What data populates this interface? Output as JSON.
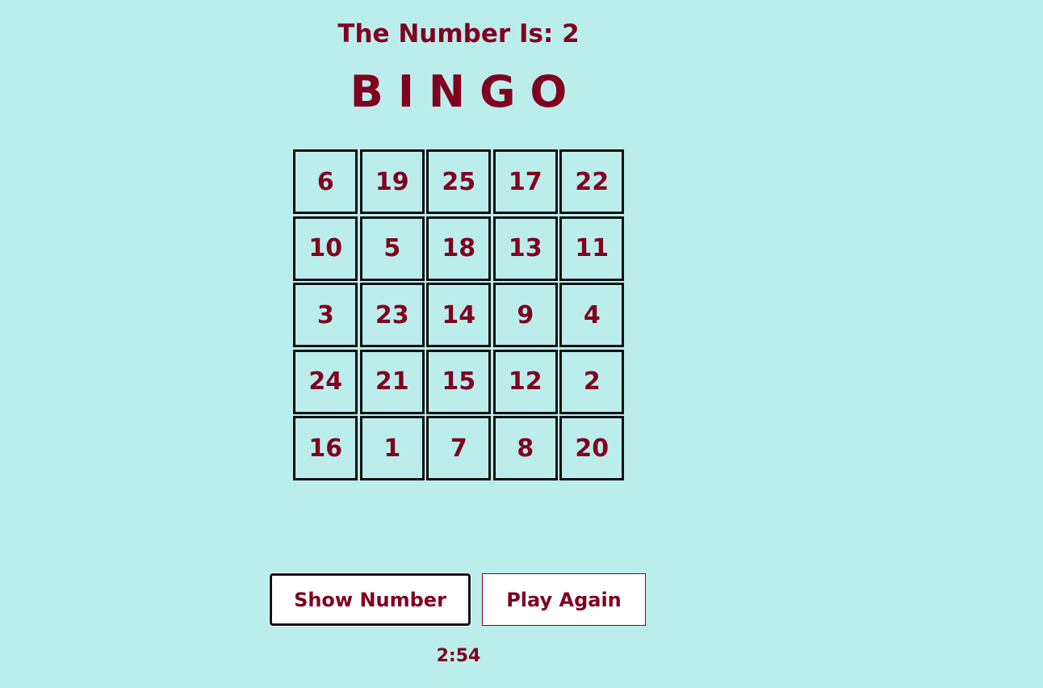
{
  "header": {
    "number_label": "The Number Is: 2",
    "title": "BINGO"
  },
  "board": {
    "cells": [
      [
        "6",
        "19",
        "25",
        "17",
        "22"
      ],
      [
        "10",
        "5",
        "18",
        "13",
        "11"
      ],
      [
        "3",
        "23",
        "14",
        "9",
        "4"
      ],
      [
        "24",
        "21",
        "15",
        "12",
        "2"
      ],
      [
        "16",
        "1",
        "7",
        "8",
        "20"
      ]
    ]
  },
  "controls": {
    "show_number_label": "Show Number",
    "play_again_label": "Play Again"
  },
  "timer": {
    "value": "2:54"
  },
  "colors": {
    "background": "#bbeeea",
    "accent": "#800020",
    "cell_border": "#111111"
  }
}
